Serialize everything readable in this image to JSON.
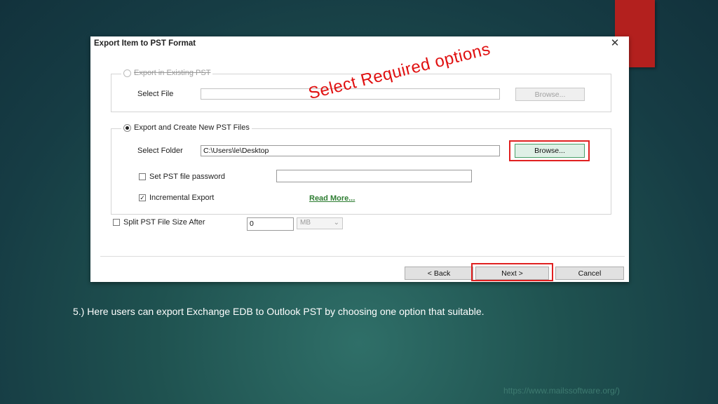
{
  "dialog": {
    "title": "Export Item to PST Format",
    "close_glyph": "✕",
    "existing_group": {
      "legend": "Export in Existing PST",
      "select_file_label": "Select File",
      "select_file_value": "",
      "browse_label": "Browse..."
    },
    "new_group": {
      "legend": "Export and Create New PST Files",
      "select_folder_label": "Select Folder",
      "select_folder_value": "C:\\Users\\le\\Desktop",
      "browse_label": "Browse...",
      "password_label": "Set PST file password",
      "password_checked": false,
      "password_value": "",
      "incremental_label": "Incremental Export",
      "incremental_checked": true,
      "read_more_label": "Read More..."
    },
    "split": {
      "label": "Split PST File Size After",
      "checked": false,
      "size_value": "0",
      "unit_value": "MB"
    },
    "buttons": {
      "back": "< Back",
      "next": "Next >",
      "cancel": "Cancel"
    },
    "annotation": "Select Required options"
  },
  "caption": "5.) Here users can export Exchange EDB to Outlook PST by choosing one option that suitable.",
  "footer_url": "https://www.mailssoftware.org/)",
  "colors": {
    "accent_red": "#b3201e",
    "highlight_red": "#e02020",
    "link_green": "#2e7d32"
  }
}
